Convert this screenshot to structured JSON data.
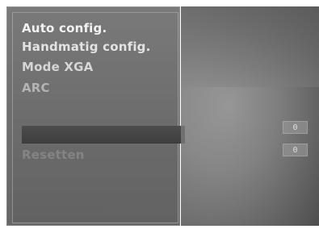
{
  "menu": {
    "items": [
      {
        "label": "Auto config."
      },
      {
        "label": "Handmatig config."
      },
      {
        "label": "Mode XGA"
      },
      {
        "label": "ARC"
      },
      {
        "label": ""
      },
      {
        "label": ""
      },
      {
        "label": "Resetten"
      }
    ]
  },
  "right_panel": {
    "values": [
      {
        "label": "0"
      },
      {
        "label": "0"
      }
    ]
  },
  "colors": {
    "menu_background": "#707070",
    "highlight": "#434343",
    "text_primary": "#f2f2f2",
    "text_dim": "#9f9f9f"
  },
  "icons": {
    "menu_item": "text-option",
    "value_box": "value-pill"
  }
}
